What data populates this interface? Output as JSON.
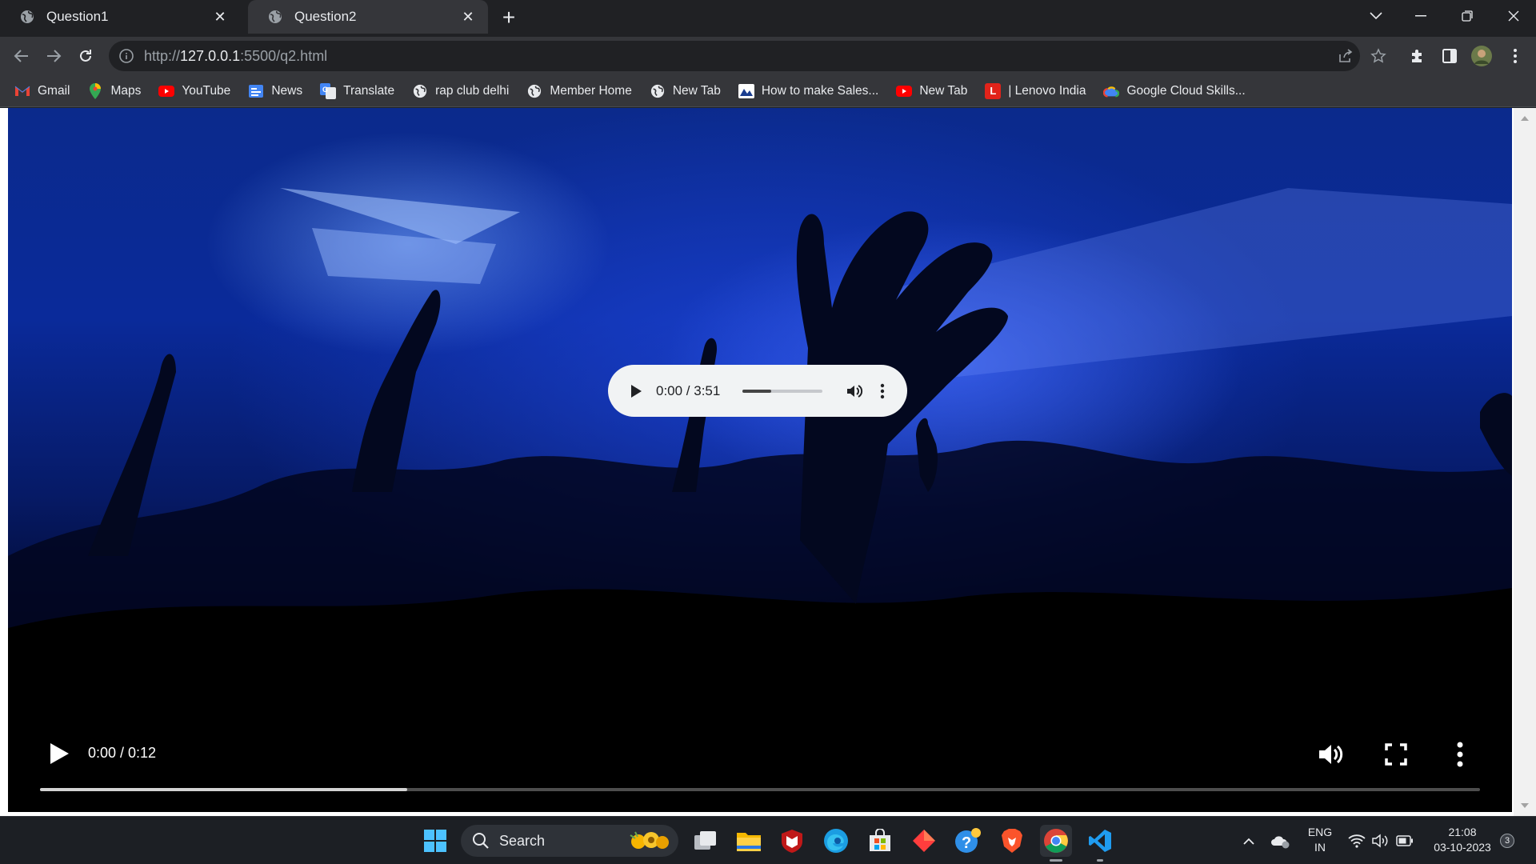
{
  "browser": {
    "tabs": [
      {
        "title": "Question1",
        "active": false
      },
      {
        "title": "Question2",
        "active": true
      }
    ],
    "url_prefix": "http://",
    "url_host": "127.0.0.1",
    "url_rest": ":5500/q2.html",
    "bookmarks": [
      {
        "label": "Gmail",
        "icon": "gmail-icon"
      },
      {
        "label": "Maps",
        "icon": "maps-icon"
      },
      {
        "label": "YouTube",
        "icon": "youtube-icon"
      },
      {
        "label": "News",
        "icon": "news-icon"
      },
      {
        "label": "Translate",
        "icon": "translate-icon"
      },
      {
        "label": "rap club delhi",
        "icon": "globe-icon"
      },
      {
        "label": "Member Home",
        "icon": "globe-icon"
      },
      {
        "label": "New Tab",
        "icon": "globe-icon"
      },
      {
        "label": "How to make Sales...",
        "icon": "site-icon"
      },
      {
        "label": "New Tab",
        "icon": "youtube-icon"
      },
      {
        "label": "| Lenovo India",
        "icon": "lenovo-icon"
      },
      {
        "label": "Google Cloud Skills...",
        "icon": "cloud-icon"
      }
    ]
  },
  "audio_player": {
    "time": "0:00 / 3:51",
    "volume_level": 0.36
  },
  "video_player": {
    "time": "0:00 / 0:12",
    "buffered": 0.255
  },
  "taskbar": {
    "search_label": "Search",
    "lang_line1": "ENG",
    "lang_line2": "IN",
    "clock_time": "21:08",
    "clock_date": "03-10-2023",
    "notification_count": "3"
  },
  "colors": {
    "tab_strip": "#202124",
    "toolbar": "#35363a",
    "video_blue": "#0a2a9a",
    "taskbar": "#1c1f24"
  }
}
